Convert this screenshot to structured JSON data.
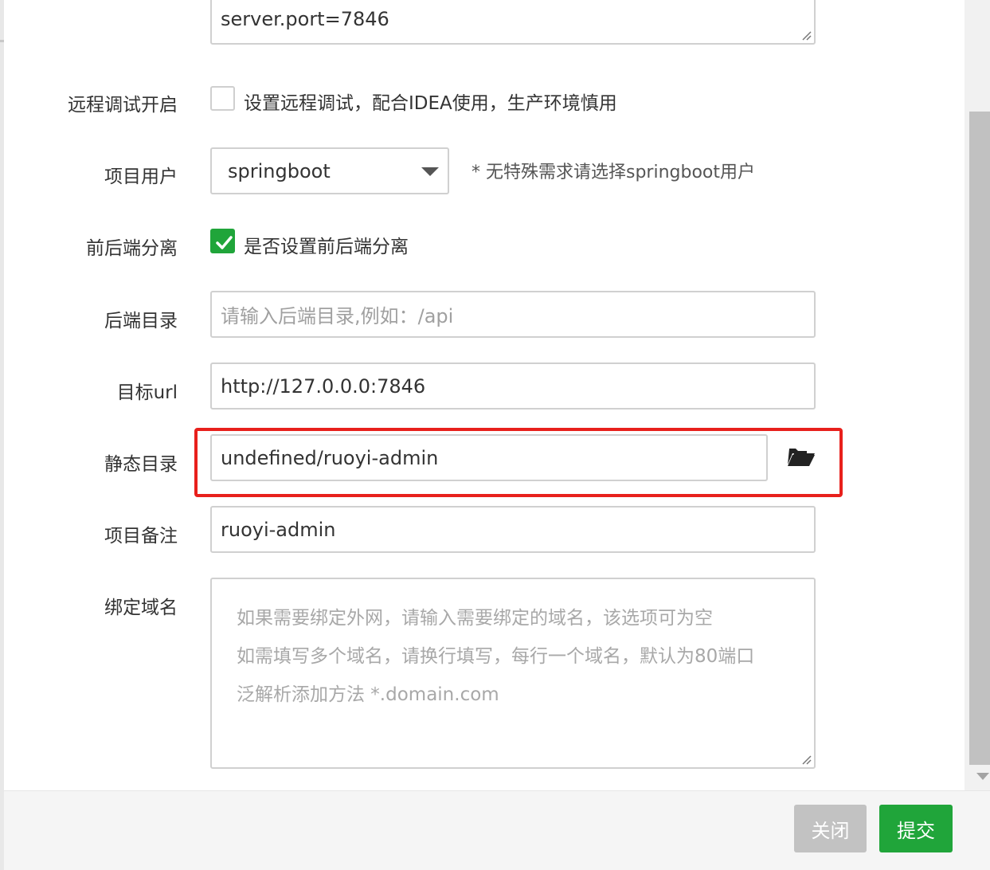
{
  "form": {
    "config_textarea": {
      "value": "server.port=7846"
    },
    "remote_debug": {
      "label": "远程调试开启",
      "checked": false,
      "text": "设置远程调试，配合IDEA使用，生产环境慎用"
    },
    "project_user": {
      "label": "项目用户",
      "value": "springboot",
      "hint": "* 无特殊需求请选择springboot用户"
    },
    "frontend_separation": {
      "label": "前后端分离",
      "checked": true,
      "text": "是否设置前后端分离"
    },
    "backend_dir": {
      "label": "后端目录",
      "placeholder": "请输入后端目录,例如：/api",
      "value": ""
    },
    "target_url": {
      "label": "目标url",
      "value": "http://127.0.0.0:7846"
    },
    "static_dir": {
      "label": "静态目录",
      "value": "undefined/ruoyi-admin",
      "button_icon": "folder-open-icon"
    },
    "project_note": {
      "label": "项目备注",
      "value": "ruoyi-admin"
    },
    "bind_domain": {
      "label": "绑定域名",
      "placeholder_lines": [
        "如果需要绑定外网，请输入需要绑定的域名，该选项可为空",
        "如需填写多个域名，请换行填写，每行一个域名，默认为80端口",
        "泛解析添加方法 *.domain.com"
      ]
    }
  },
  "footer": {
    "close_label": "关闭",
    "submit_label": "提交"
  },
  "colors": {
    "accent": "#20a53a",
    "highlight": "#e8201c",
    "disabled_button": "#c2c2c2"
  }
}
